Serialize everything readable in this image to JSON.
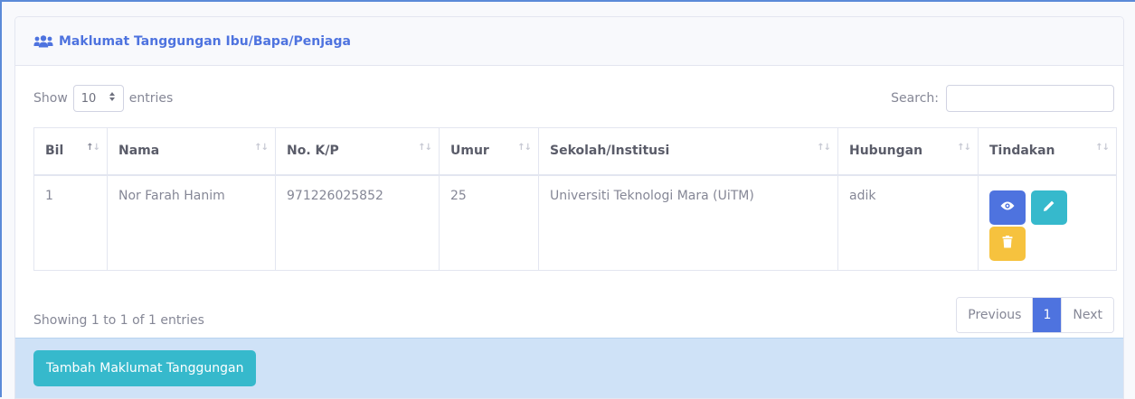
{
  "card": {
    "title": "Maklumat Tanggungan Ibu/Bapa/Penjaga",
    "title_icon": "users-icon"
  },
  "controls": {
    "show_label": "Show",
    "entries_value": "10",
    "entries_label": "entries",
    "search_label": "Search:",
    "search_value": ""
  },
  "table": {
    "columns": [
      "Bil",
      "Nama",
      "No. K/P",
      "Umur",
      "Sekolah/Institusi",
      "Hubungan",
      "Tindakan"
    ],
    "sorted_column": "Bil",
    "rows": [
      {
        "bil": "1",
        "nama": "Nor Farah Hanim",
        "no_kp": "971226025852",
        "umur": "25",
        "sekolah": "Universiti Teknologi Mara (UiTM)",
        "hubungan": "adik",
        "actions": [
          "eye-icon",
          "pencil-icon",
          "trash-icon"
        ]
      }
    ]
  },
  "info": "Showing 1 to 1 of 1 entries",
  "pagination": {
    "previous": "Previous",
    "pages": [
      "1"
    ],
    "active_page": "1",
    "next": "Next"
  },
  "footer": {
    "add_button": "Tambah Maklumat Tanggungan"
  },
  "colors": {
    "primary": "#4e73df",
    "info": "#36b9cc",
    "warning": "#f6c23e",
    "footer_bg": "#cfe2f7"
  }
}
